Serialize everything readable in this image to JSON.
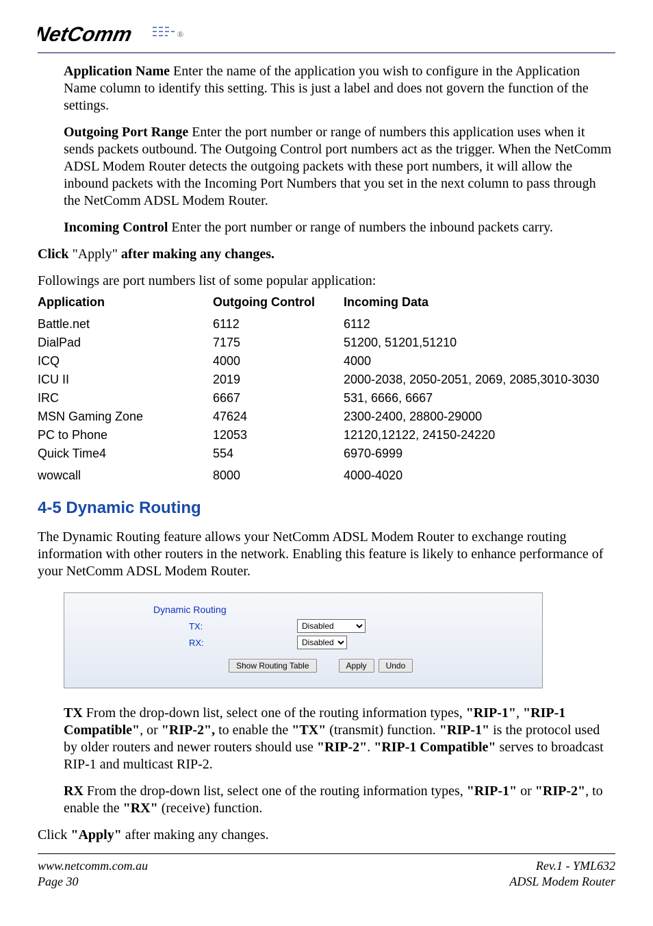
{
  "logo_text": "NetComm",
  "definitions": {
    "app_name": {
      "term": "Application Name",
      "body": " Enter the name of the application you wish to configure in the Application Name column to identify this setting.  This is just a label and does not govern the function of the settings."
    },
    "outgoing": {
      "term": "Outgoing Port Range",
      "body": " Enter the port number or range of numbers this application uses when it sends packets outbound. The Outgoing Control port numbers act as the trigger. When the NetComm ADSL Modem Router detects the outgoing packets with these port numbers, it will allow the inbound packets with the Incoming Port Numbers that you set in the next column to pass through the NetComm ADSL Modem Router."
    },
    "incoming": {
      "term": "Incoming Control",
      "body": " Enter the port number or range of numbers the inbound packets carry."
    }
  },
  "click_apply_prefix": "Click ",
  "click_apply_quoted": "\"Apply\"",
  "click_apply_suffix": " after making any changes.",
  "table_intro": "Followings are port numbers list of some popular application:",
  "table_headers": {
    "app": "Application",
    "out": "Outgoing Control",
    "in": "Incoming Data"
  },
  "ports": [
    {
      "app": "Battle.net",
      "out": "6112",
      "in": "6112"
    },
    {
      "app": "DialPad",
      "out": "7175",
      "in": "51200, 51201,51210"
    },
    {
      "app": "ICQ",
      "out": "4000",
      "in": "4000"
    },
    {
      "app": "ICU II",
      "out": "2019",
      "in": "2000-2038, 2050-2051, 2069, 2085,3010-3030"
    },
    {
      "app": "IRC",
      "out": "6667",
      "in": "531, 6666, 6667"
    },
    {
      "app": "MSN Gaming Zone",
      "out": "47624",
      "in": "2300-2400, 28800-29000"
    },
    {
      "app": "PC to Phone",
      "out": "12053",
      "in": "12120,12122, 24150-24220"
    },
    {
      "app": "Quick Time4",
      "out": "554",
      "in": "6970-6999"
    },
    {
      "app": "wowcall",
      "out": "8000",
      "in": "4000-4020"
    }
  ],
  "section_heading": "4-5 Dynamic Routing",
  "dyn_routing_intro": "The Dynamic Routing feature allows your NetComm ADSL Modem Router to exchange routing information with other routers in the network. Enabling this feature is likely to enhance performance of your NetComm ADSL Modem Router.",
  "screenshot": {
    "title": "Dynamic Routing",
    "tx_label": "TX:",
    "rx_label": "RX:",
    "tx_value": "Disabled",
    "rx_value": "Disabled",
    "btn_table": "Show Routing Table",
    "btn_apply": "Apply",
    "btn_undo": "Undo"
  },
  "tx_def_term": "TX",
  "tx_def_body_1": " From the drop-down list, select one of the routing information types, ",
  "tx_rip1": "\"RIP-1\"",
  "tx_sep1": ", ",
  "tx_rip1c": "\"RIP-1 Compatible\"",
  "tx_sep2": ", or ",
  "tx_rip2": "\"RIP-2\",",
  "tx_body_2": " to enable the ",
  "tx_tx": "\"TX\"",
  "tx_body_3": " (transmit) function. ",
  "tx_rip1b": "\"RIP-1\"",
  "tx_body_4": " is the protocol used by older routers and newer routers should use ",
  "tx_rip2b": "\"RIP-2\"",
  "tx_dot": ". ",
  "tx_rip1cb": "\"RIP-1 Compatible\"",
  "tx_body_5": " serves to broadcast RIP-1 and multicast RIP-2.",
  "rx_def_term": "RX",
  "rx_body_1": " From the drop-down list, select one of the routing information types, ",
  "rx_rip1": "\"RIP-1\"",
  "rx_or": " or ",
  "rx_rip2": "\"RIP-2\"",
  "rx_body_2": ", to enable the ",
  "rx_rx": "\"RX\"",
  "rx_body_3": " (receive) function.",
  "final_click_1": "Click ",
  "final_click_bold": "\"Apply\"",
  "final_click_2": " after making any changes.",
  "footer": {
    "left1": "www.netcomm.com.au",
    "left2": "Page 30",
    "right1": "Rev.1 - YML632",
    "right2": "ADSL Modem Router"
  }
}
